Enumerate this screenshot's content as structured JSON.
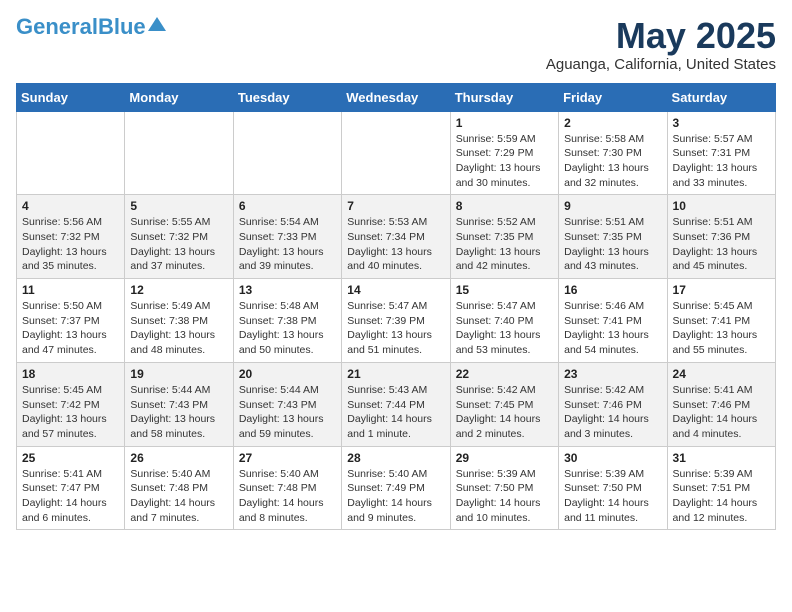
{
  "header": {
    "logo_general": "General",
    "logo_blue": "Blue",
    "month_title": "May 2025",
    "location": "Aguanga, California, United States"
  },
  "days_of_week": [
    "Sunday",
    "Monday",
    "Tuesday",
    "Wednesday",
    "Thursday",
    "Friday",
    "Saturday"
  ],
  "weeks": [
    [
      {
        "day": "",
        "info": ""
      },
      {
        "day": "",
        "info": ""
      },
      {
        "day": "",
        "info": ""
      },
      {
        "day": "",
        "info": ""
      },
      {
        "day": "1",
        "info": "Sunrise: 5:59 AM\nSunset: 7:29 PM\nDaylight: 13 hours\nand 30 minutes."
      },
      {
        "day": "2",
        "info": "Sunrise: 5:58 AM\nSunset: 7:30 PM\nDaylight: 13 hours\nand 32 minutes."
      },
      {
        "day": "3",
        "info": "Sunrise: 5:57 AM\nSunset: 7:31 PM\nDaylight: 13 hours\nand 33 minutes."
      }
    ],
    [
      {
        "day": "4",
        "info": "Sunrise: 5:56 AM\nSunset: 7:32 PM\nDaylight: 13 hours\nand 35 minutes."
      },
      {
        "day": "5",
        "info": "Sunrise: 5:55 AM\nSunset: 7:32 PM\nDaylight: 13 hours\nand 37 minutes."
      },
      {
        "day": "6",
        "info": "Sunrise: 5:54 AM\nSunset: 7:33 PM\nDaylight: 13 hours\nand 39 minutes."
      },
      {
        "day": "7",
        "info": "Sunrise: 5:53 AM\nSunset: 7:34 PM\nDaylight: 13 hours\nand 40 minutes."
      },
      {
        "day": "8",
        "info": "Sunrise: 5:52 AM\nSunset: 7:35 PM\nDaylight: 13 hours\nand 42 minutes."
      },
      {
        "day": "9",
        "info": "Sunrise: 5:51 AM\nSunset: 7:35 PM\nDaylight: 13 hours\nand 43 minutes."
      },
      {
        "day": "10",
        "info": "Sunrise: 5:51 AM\nSunset: 7:36 PM\nDaylight: 13 hours\nand 45 minutes."
      }
    ],
    [
      {
        "day": "11",
        "info": "Sunrise: 5:50 AM\nSunset: 7:37 PM\nDaylight: 13 hours\nand 47 minutes."
      },
      {
        "day": "12",
        "info": "Sunrise: 5:49 AM\nSunset: 7:38 PM\nDaylight: 13 hours\nand 48 minutes."
      },
      {
        "day": "13",
        "info": "Sunrise: 5:48 AM\nSunset: 7:38 PM\nDaylight: 13 hours\nand 50 minutes."
      },
      {
        "day": "14",
        "info": "Sunrise: 5:47 AM\nSunset: 7:39 PM\nDaylight: 13 hours\nand 51 minutes."
      },
      {
        "day": "15",
        "info": "Sunrise: 5:47 AM\nSunset: 7:40 PM\nDaylight: 13 hours\nand 53 minutes."
      },
      {
        "day": "16",
        "info": "Sunrise: 5:46 AM\nSunset: 7:41 PM\nDaylight: 13 hours\nand 54 minutes."
      },
      {
        "day": "17",
        "info": "Sunrise: 5:45 AM\nSunset: 7:41 PM\nDaylight: 13 hours\nand 55 minutes."
      }
    ],
    [
      {
        "day": "18",
        "info": "Sunrise: 5:45 AM\nSunset: 7:42 PM\nDaylight: 13 hours\nand 57 minutes."
      },
      {
        "day": "19",
        "info": "Sunrise: 5:44 AM\nSunset: 7:43 PM\nDaylight: 13 hours\nand 58 minutes."
      },
      {
        "day": "20",
        "info": "Sunrise: 5:44 AM\nSunset: 7:43 PM\nDaylight: 13 hours\nand 59 minutes."
      },
      {
        "day": "21",
        "info": "Sunrise: 5:43 AM\nSunset: 7:44 PM\nDaylight: 14 hours\nand 1 minute."
      },
      {
        "day": "22",
        "info": "Sunrise: 5:42 AM\nSunset: 7:45 PM\nDaylight: 14 hours\nand 2 minutes."
      },
      {
        "day": "23",
        "info": "Sunrise: 5:42 AM\nSunset: 7:46 PM\nDaylight: 14 hours\nand 3 minutes."
      },
      {
        "day": "24",
        "info": "Sunrise: 5:41 AM\nSunset: 7:46 PM\nDaylight: 14 hours\nand 4 minutes."
      }
    ],
    [
      {
        "day": "25",
        "info": "Sunrise: 5:41 AM\nSunset: 7:47 PM\nDaylight: 14 hours\nand 6 minutes."
      },
      {
        "day": "26",
        "info": "Sunrise: 5:40 AM\nSunset: 7:48 PM\nDaylight: 14 hours\nand 7 minutes."
      },
      {
        "day": "27",
        "info": "Sunrise: 5:40 AM\nSunset: 7:48 PM\nDaylight: 14 hours\nand 8 minutes."
      },
      {
        "day": "28",
        "info": "Sunrise: 5:40 AM\nSunset: 7:49 PM\nDaylight: 14 hours\nand 9 minutes."
      },
      {
        "day": "29",
        "info": "Sunrise: 5:39 AM\nSunset: 7:50 PM\nDaylight: 14 hours\nand 10 minutes."
      },
      {
        "day": "30",
        "info": "Sunrise: 5:39 AM\nSunset: 7:50 PM\nDaylight: 14 hours\nand 11 minutes."
      },
      {
        "day": "31",
        "info": "Sunrise: 5:39 AM\nSunset: 7:51 PM\nDaylight: 14 hours\nand 12 minutes."
      }
    ]
  ]
}
